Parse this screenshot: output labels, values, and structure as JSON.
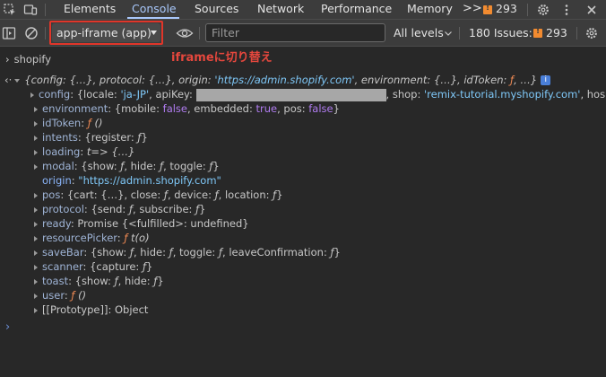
{
  "tabs": [
    {
      "label": "Elements",
      "active": false
    },
    {
      "label": "Console",
      "active": true
    },
    {
      "label": "Sources",
      "active": false
    },
    {
      "label": "Network",
      "active": false
    },
    {
      "label": "Performance",
      "active": false
    },
    {
      "label": "Memory",
      "active": false
    }
  ],
  "tabbar": {
    "overflow": ">>",
    "issues_count": "293"
  },
  "toolbar": {
    "context": "app-iframe (app)",
    "filter_placeholder": "Filter",
    "levels": "All levels",
    "issues_label": "180 Issues:",
    "issues_count": "293"
  },
  "annotation": "iframeに切り替え",
  "console": {
    "command": "shopify",
    "summary": {
      "prefix": "{config: {…}, protocol: {…}, origin: ",
      "origin": "'https://admin.shopify.com'",
      "suffix": ", environment: {…}, idToken: ",
      "f": "ƒ",
      "tail": ", …}"
    },
    "config": {
      "key": "config",
      "open": ": {locale: ",
      "locale": "'ja-JP'",
      "apikey_label": ", apiKey: ",
      "shop_label": ", shop: ",
      "shop": "'remix-tutorial.myshopify.com'",
      "hos": ", hos"
    },
    "props": {
      "environment": {
        "key": "environment",
        "pre": ": {mobile: ",
        "v1": "false",
        "m1": ", embedded: ",
        "v2": "true",
        "m2": ", pos: ",
        "v3": "false",
        "end": "}"
      },
      "idToken": {
        "key": "idToken",
        "sep": ": ",
        "f": "ƒ",
        "rest": " ()"
      },
      "intents": {
        "key": "intents",
        "pre": ": {register: ",
        "f": "ƒ",
        "end": "}"
      },
      "loading": {
        "key": "loading",
        "sep": ": ",
        "val": "t=> {…}"
      },
      "modal": {
        "key": "modal",
        "pre": ": {show: ",
        "m1": ", hide: ",
        "m2": ", toggle: ",
        "f": "ƒ",
        "end": "}"
      },
      "origin": {
        "key": "origin",
        "sep": ": ",
        "val": "\"https://admin.shopify.com\""
      },
      "pos": {
        "key": "pos",
        "pre": ": {cart: {…}, close: ",
        "m1": ", device: ",
        "m2": ", location: ",
        "f": "ƒ",
        "end": "}"
      },
      "protocol": {
        "key": "protocol",
        "pre": ": {send: ",
        "m1": ", subscribe: ",
        "f": "ƒ",
        "end": "}"
      },
      "ready": {
        "key": "ready",
        "pre": ": Promise  {<fulfilled>: undefined}"
      },
      "resourcePicker": {
        "key": "resourcePicker",
        "sep": ": ",
        "f": "ƒ",
        "rest": " t(o)"
      },
      "saveBar": {
        "key": "saveBar",
        "pre": ": {show: ",
        "m1": ", hide: ",
        "m2": ", toggle: ",
        "m3": ", leaveConfirmation: ",
        "f": "ƒ",
        "end": "}"
      },
      "scanner": {
        "key": "scanner",
        "pre": ": {capture: ",
        "f": "ƒ",
        "end": "}"
      },
      "toast": {
        "key": "toast",
        "pre": ": {show: ",
        "m1": ", hide: ",
        "f": "ƒ",
        "end": "}"
      },
      "user": {
        "key": "user",
        "sep": ": ",
        "f": "ƒ",
        "rest": " ()"
      },
      "prototype": {
        "key": "[[Prototype]]",
        "sep": ": ",
        "val": "Object"
      }
    },
    "prompt": "›"
  },
  "colors": {
    "accent": "#a8c7fa",
    "highlight": "#e0362a",
    "warning": "#f28b30",
    "function": "#f28b54",
    "string": "#7fc8f8",
    "boolean": "#b07cf0"
  }
}
